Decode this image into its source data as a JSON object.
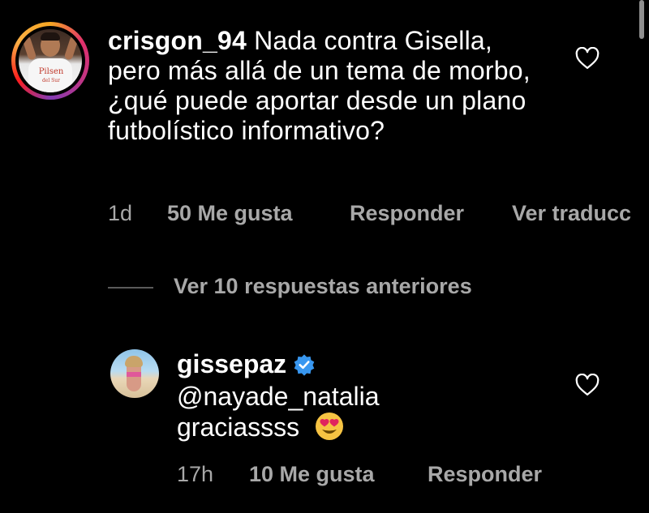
{
  "comment": {
    "username": "crisgon_94",
    "text": "Nada contra Gisella, pero más allá de un tema de morbo, ¿qué puede aportar desde un plano futbolístico informativo?",
    "time": "1d",
    "likes": "50 Me gusta",
    "reply_label": "Responder",
    "translate_label": "Ver traducc",
    "avatar_brand": "Pilsen del Sur"
  },
  "replies": {
    "view_previous_label": "Ver 10 respuestas anteriores"
  },
  "reply": {
    "username": "gissepaz",
    "mention": "@nayade_natalia",
    "text": "graciassss",
    "emoji_icon": "heart-eyes-emoji",
    "time": "17h",
    "likes": "10 Me gusta",
    "reply_label": "Responder"
  },
  "colors": {
    "background": "#000000",
    "text": "#ffffff",
    "muted": "#a8a8a8",
    "verified": "#3897f0"
  }
}
